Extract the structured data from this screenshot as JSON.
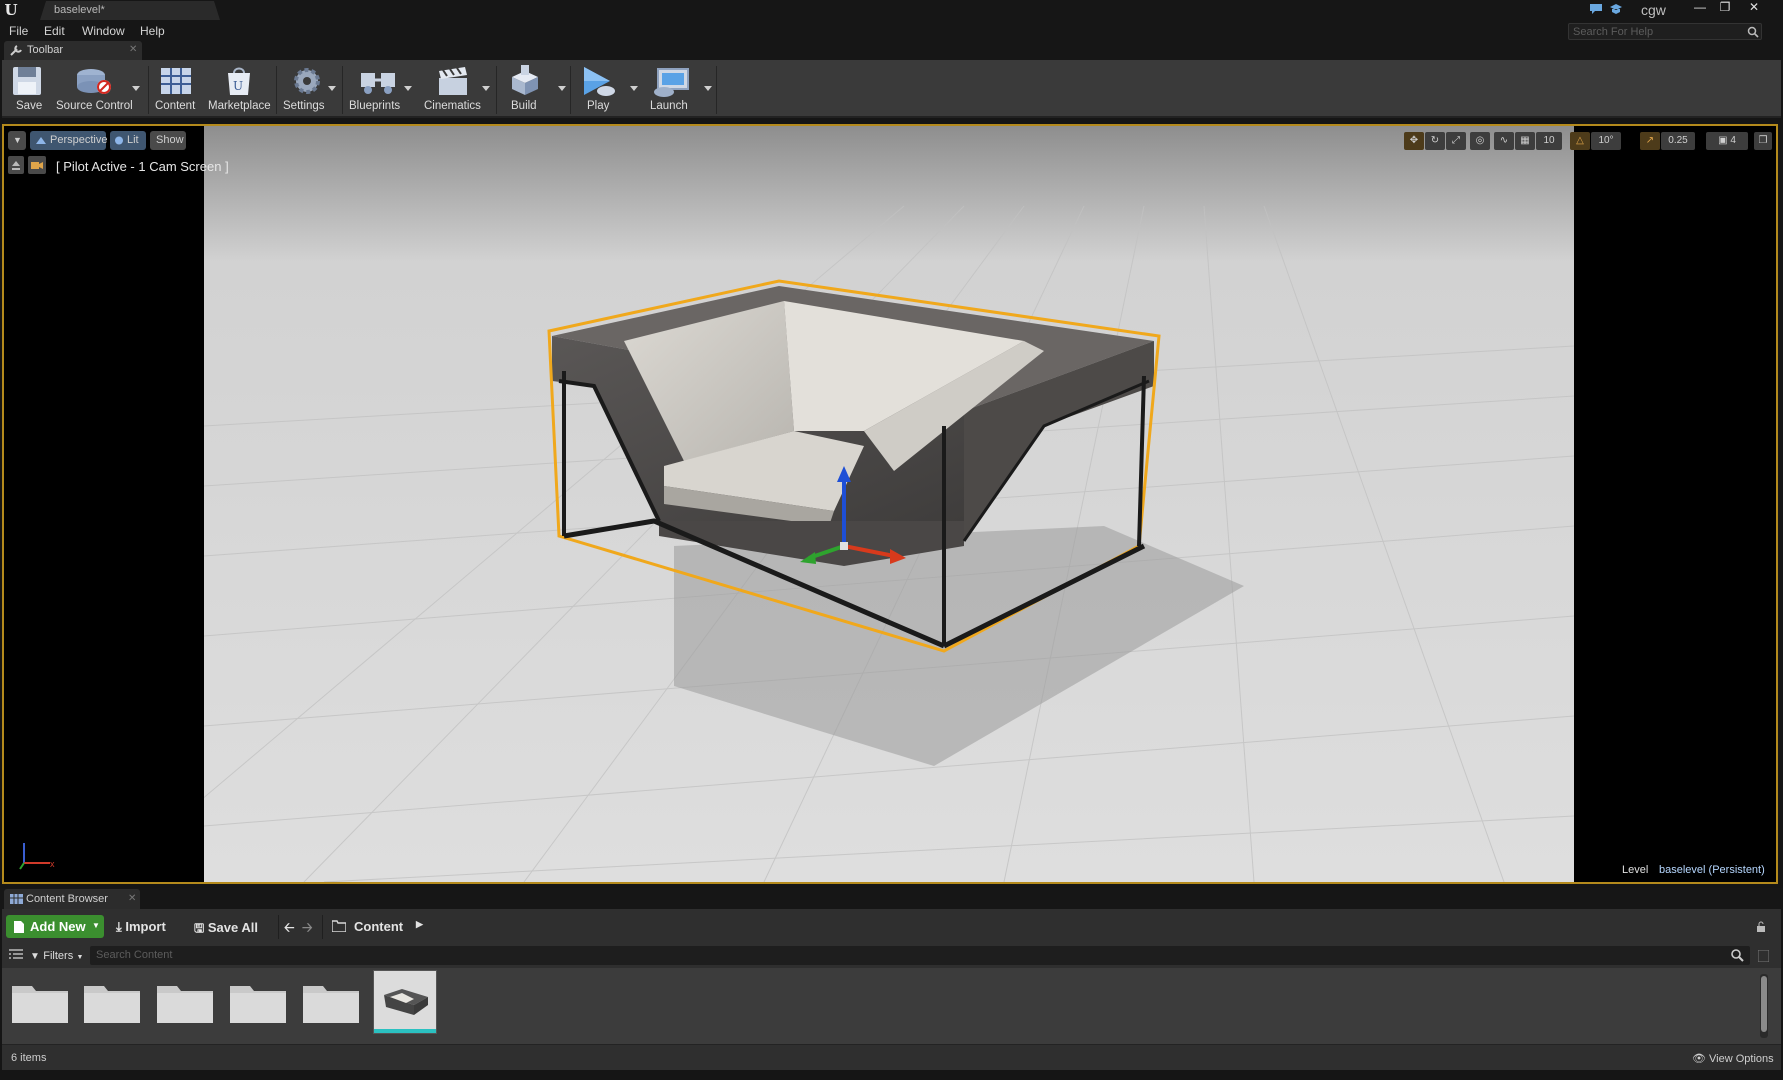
{
  "window": {
    "tab_title": "baselevel*",
    "user": "cgw"
  },
  "menu": [
    "File",
    "Edit",
    "Window",
    "Help"
  ],
  "help_search": {
    "placeholder": "Search For Help"
  },
  "toolbar_panel": {
    "tab_label": "Toolbar"
  },
  "toolbar": {
    "buttons": [
      {
        "label": "Save",
        "icon": "save-icon"
      },
      {
        "label": "Source Control",
        "icon": "source-control-icon"
      },
      {
        "label": "Content",
        "icon": "content-icon"
      },
      {
        "label": "Marketplace",
        "icon": "marketplace-icon"
      },
      {
        "label": "Settings",
        "icon": "settings-icon"
      },
      {
        "label": "Blueprints",
        "icon": "blueprints-icon"
      },
      {
        "label": "Cinematics",
        "icon": "cinematics-icon"
      },
      {
        "label": "Build",
        "icon": "build-icon"
      },
      {
        "label": "Play",
        "icon": "play-icon"
      },
      {
        "label": "Launch",
        "icon": "launch-icon"
      }
    ]
  },
  "viewport": {
    "view_mode": "Perspective",
    "lit_mode": "Lit",
    "show_label": "Show",
    "pilot_label": "[ Pilot Active - 1 Cam Screen ]",
    "grid_snap": "10",
    "rotation_snap": "10°",
    "scale_snap": "0.25",
    "camera_speed": "4",
    "level_label": "Level",
    "level_value": "baselevel (Persistent)",
    "accent_color": "#b48a1c"
  },
  "content_browser": {
    "tab_label": "Content Browser",
    "add_new": "Add New",
    "import": "Import",
    "save_all": "Save All",
    "path": "Content",
    "filters": "Filters",
    "search_placeholder": "Search Content",
    "item_count": "6 items",
    "view_options": "View Options",
    "add_new_color": "#3b8f2f"
  }
}
